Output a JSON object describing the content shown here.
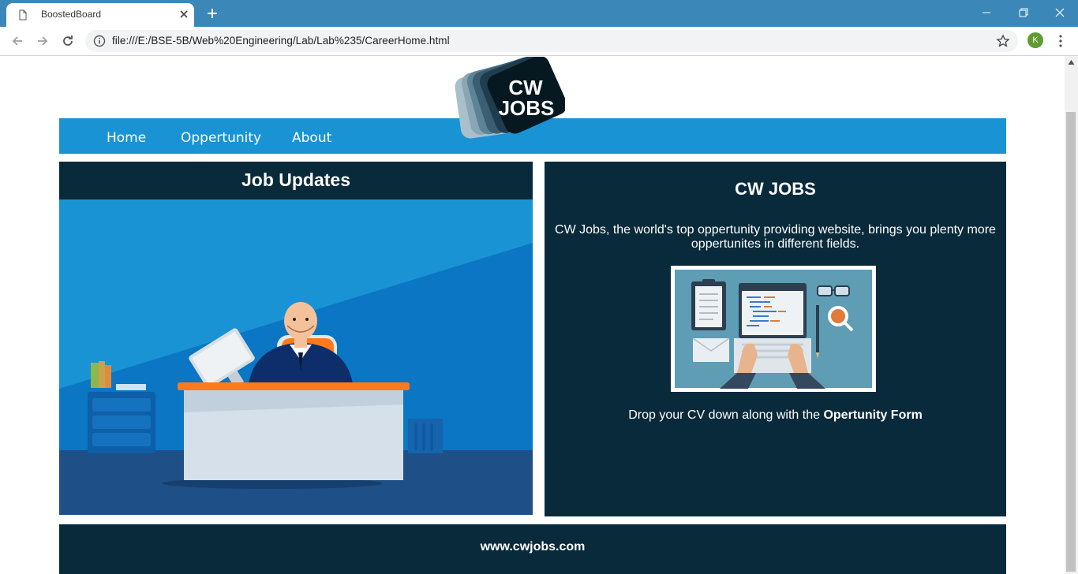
{
  "browser": {
    "tab_title": "BoostedBoard",
    "url": "file:///E:/BSE-5B/Web%20Engineering/Lab/Lab%235/CareerHome.html",
    "profile_initial": "K"
  },
  "nav": {
    "items": [
      "Home",
      "Oppertunity",
      "About"
    ]
  },
  "logo": {
    "line1": "CW",
    "line2": "JOBS"
  },
  "job_updates": {
    "title": "Job Updates"
  },
  "about_card": {
    "title": "CW JOBS",
    "description": "CW Jobs, the world's top oppertunity providing website, brings you plenty more oppertunites in different fields.",
    "cta_prefix": "Drop your CV down along with the ",
    "cta_link": "Opertunity Form"
  },
  "footer": {
    "link": "www.cwjobs.com"
  },
  "colors": {
    "nav_blue": "#1a93d5",
    "panel_dark": "#082a3a",
    "chrome_blue": "#3b87b8"
  }
}
